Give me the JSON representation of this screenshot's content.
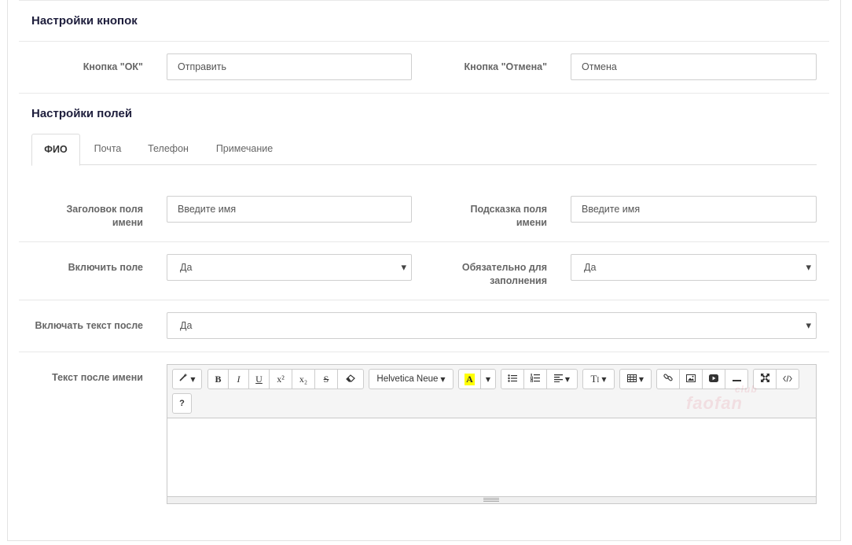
{
  "buttons_section": {
    "title": "Настройки кнопок",
    "ok_label": "Кнопка \"ОК\"",
    "ok_value": "Отправить",
    "cancel_label": "Кнопка \"Отмена\"",
    "cancel_value": "Отмена"
  },
  "fields_section": {
    "title": "Настройки полей",
    "tabs": [
      {
        "label": "ФИО",
        "active": true
      },
      {
        "label": "Почта",
        "active": false
      },
      {
        "label": "Телефон",
        "active": false
      },
      {
        "label": "Примечание",
        "active": false
      }
    ],
    "name_title_label": "Заголовок поля имени",
    "name_title_value": "Введите имя",
    "name_hint_label": "Подсказка поля имени",
    "name_hint_value": "Введите имя",
    "enable_field_label": "Включить поле",
    "enable_field_value": "Да",
    "required_label": "Обязательно для заполнения",
    "required_value": "Да",
    "include_text_after_label": "Включать текст после",
    "include_text_after_value": "Да",
    "text_after_name_label": "Текст после имени"
  },
  "editor": {
    "toolbar": {
      "magic": "magic-wand-icon",
      "bold": "B",
      "italic": "I",
      "underline": "U",
      "superscript": "x²",
      "subscript": "x₂",
      "strikethrough": "S",
      "eraser": "eraser-icon",
      "font_family": "Helvetica Neue",
      "color": "A",
      "color_highlight": "#ffff00",
      "help": "?"
    },
    "content": "",
    "watermark": "faofan",
    "watermark_sub": "club"
  },
  "colors": {
    "section_title": "#1e1e3c",
    "label": "#666666",
    "border": "#cfcfcf"
  }
}
